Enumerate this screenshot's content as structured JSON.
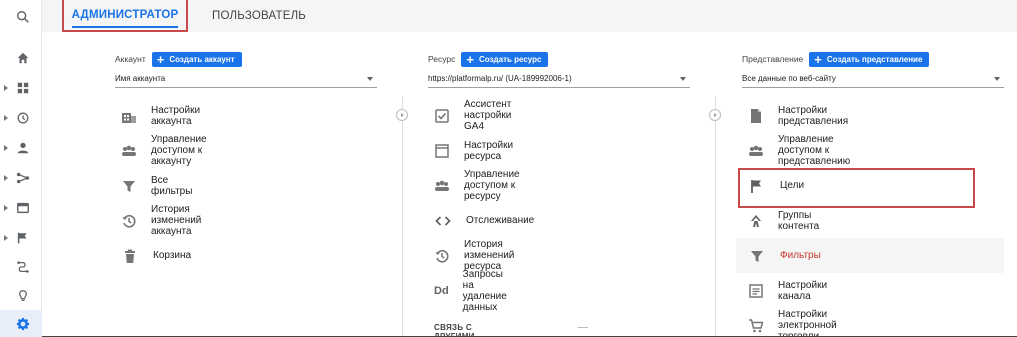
{
  "tabs": {
    "admin": "АДМИНИСТРАТОР",
    "user": "ПОЛЬЗОВАТЕЛЬ"
  },
  "account": {
    "label": "Аккаунт",
    "create": "Создать аккаунт",
    "selected": "Имя аккаунта",
    "items": [
      {
        "icon": "building-icon",
        "label": "Настройки аккаунта"
      },
      {
        "icon": "people-icon",
        "label": "Управление доступом к аккаунту"
      },
      {
        "icon": "filter-icon",
        "label": "Все фильтры"
      },
      {
        "icon": "history-icon",
        "label": "История изменений аккаунта"
      },
      {
        "icon": "trash-icon",
        "label": "Корзина"
      }
    ]
  },
  "property": {
    "label": "Ресурс",
    "create": "Создать ресурс",
    "selected": "https://platformalp.ru/ (UA-189992006-1)",
    "items": [
      {
        "icon": "checkbox-icon",
        "label": "Ассистент настройки GA4"
      },
      {
        "icon": "window-icon",
        "label": "Настройки ресурса"
      },
      {
        "icon": "people-icon",
        "label": "Управление доступом к ресурсу"
      },
      {
        "icon": "code-icon",
        "label": "Отслеживание"
      },
      {
        "icon": "history-icon",
        "label": "История изменений ресурса"
      },
      {
        "icon": "dd-icon",
        "label": "Запросы на удаление данных"
      }
    ],
    "section": "СВЯЗЬ С ДРУГИМИ ПРОДУКТАМИ"
  },
  "view": {
    "label": "Представление",
    "create": "Создать представление",
    "selected": "Все данные по веб-сайту",
    "items": [
      {
        "icon": "document-icon",
        "label": "Настройки представления"
      },
      {
        "icon": "people-icon",
        "label": "Управление доступом к представлению"
      },
      {
        "icon": "flag-icon",
        "label": "Цели"
      },
      {
        "icon": "content-groups-icon",
        "label": "Группы контента"
      },
      {
        "icon": "filter-icon",
        "label": "Фильтры"
      },
      {
        "icon": "channel-icon",
        "label": "Настройки канала"
      },
      {
        "icon": "cart-icon",
        "label": "Настройки электронной торговли"
      }
    ]
  },
  "colors": {
    "accent": "#1a73e8",
    "highlight": "#c64a4a",
    "filters": "#c5382b"
  }
}
